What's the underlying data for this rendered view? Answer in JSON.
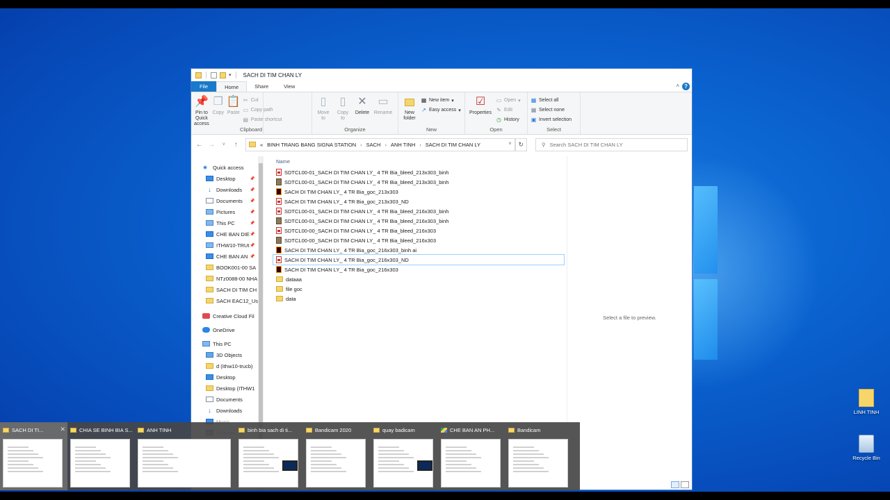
{
  "window": {
    "title": "SACH DI TIM CHAN LY",
    "tabs": [
      "File",
      "Home",
      "Share",
      "View"
    ]
  },
  "ribbon": {
    "clipboard": {
      "name": "Clipboard",
      "pin": "Pin to Quick access",
      "copy": "Copy",
      "paste": "Paste",
      "cut": "Cut",
      "copy_path": "Copy path",
      "paste_shortcut": "Paste shortcut"
    },
    "organize": {
      "name": "Organize",
      "move_to": "Move to",
      "copy_to": "Copy to",
      "delete": "Delete",
      "rename": "Rename"
    },
    "new": {
      "name": "New",
      "new_folder": "New folder",
      "new_item": "New item",
      "easy_access": "Easy access"
    },
    "open": {
      "name": "Open",
      "properties": "Properties",
      "open": "Open",
      "edit": "Edit",
      "history": "History"
    },
    "select": {
      "name": "Select",
      "select_all": "Select all",
      "select_none": "Select none",
      "invert": "Invert selection"
    }
  },
  "address": {
    "prefix": "«",
    "crumbs": [
      "BINH TRANG BANG SIGNA STATION",
      "SACH",
      "ANH TINH",
      "SACH DI TIM CHAN LY"
    ],
    "search_placeholder": "Search SACH DI TIM CHAN LY"
  },
  "nav": {
    "items": [
      {
        "label": "Quick access",
        "icon": "star-icon"
      },
      {
        "label": "Desktop",
        "icon": "desktop-icon"
      },
      {
        "label": "Downloads",
        "icon": "download-icon"
      },
      {
        "label": "Documents",
        "icon": "documents-icon"
      },
      {
        "label": "Pictures",
        "icon": "pictures-icon"
      },
      {
        "label": "This PC",
        "icon": "pc-icon"
      },
      {
        "label": "CHE BAN DIE",
        "icon": "drive-icon"
      },
      {
        "label": "ITHW10-TRUt",
        "icon": "network-drive-icon"
      },
      {
        "label": "CHE BAN AN",
        "icon": "drive-icon"
      },
      {
        "label": "BOOK001-00 SA",
        "icon": "folder-icon"
      },
      {
        "label": "NTz0088-00 NHA",
        "icon": "folder-icon"
      },
      {
        "label": "SACH DI TIM CH",
        "icon": "folder-icon"
      },
      {
        "label": "SACH EAC12_Us",
        "icon": "folder-icon"
      },
      {
        "label": "Creative Cloud Fil",
        "icon": "creative-cloud-icon"
      },
      {
        "label": "OneDrive",
        "icon": "onedrive-icon"
      },
      {
        "label": "This PC",
        "icon": "pc-icon"
      },
      {
        "label": "3D Objects",
        "icon": "3d-objects-icon"
      },
      {
        "label": "d (Ithw10-trucb)",
        "icon": "folder-icon"
      },
      {
        "label": "Desktop",
        "icon": "desktop-icon"
      },
      {
        "label": "Desktop (ITHW1",
        "icon": "folder-icon"
      },
      {
        "label": "Documents",
        "icon": "documents-icon"
      },
      {
        "label": "Downloads",
        "icon": "download-icon"
      },
      {
        "label": "Music",
        "icon": "music-icon"
      },
      {
        "label": "Pictures",
        "icon": "pictures-icon"
      }
    ]
  },
  "files": {
    "column_name": "Name",
    "rows": [
      {
        "name": "SDTCL00-01_SACH DI TIM CHAN LY_ 4 TR Bia_bleed_213x303_binh",
        "type": "pdf"
      },
      {
        "name": "SDTCL00-01_SACH DI TIM CHAN LY_ 4 TR Bia_bleed_213x303_binh",
        "type": "tif"
      },
      {
        "name": "SACH DI TIM CHAN LY_ 4 TR Bia_goc_213x303",
        "type": "ai"
      },
      {
        "name": "SACH DI TIM CHAN LY_ 4 TR Bia_goc_213x303_ND",
        "type": "pdf"
      },
      {
        "name": "SDTCL00-01_SACH DI TIM CHAN LY_ 4 TR Bia_bleed_216x303_binh",
        "type": "pdf"
      },
      {
        "name": "SDTCL00-01_SACH DI TIM CHAN LY_ 4 TR Bia_bleed_216x303_binh",
        "type": "tif"
      },
      {
        "name": "SDTCL00-00_SACH DI TIM CHAN LY_ 4 TR Bia_bleed_216x303",
        "type": "pdf"
      },
      {
        "name": "SDTCL00-00_SACH DI TIM CHAN LY_ 4 TR Bia_bleed_216x303",
        "type": "tif"
      },
      {
        "name": "SACH DI TIM CHAN LY_ 4 TR Bia_goc_216x303_binh ai",
        "type": "ai"
      },
      {
        "name": "SACH DI TIM CHAN LY_ 4 TR Bia_goc_216x303_ND",
        "type": "pdf"
      },
      {
        "name": "SACH DI TIM CHAN LY_ 4 TR Bia_goc_216x303",
        "type": "ai"
      },
      {
        "name": "dataaa",
        "type": "folder"
      },
      {
        "name": "file goc",
        "type": "folder"
      },
      {
        "name": "data",
        "type": "folder"
      }
    ]
  },
  "preview": {
    "text": "Select a file to preview."
  },
  "switcher": {
    "items": [
      {
        "label": "SACH DI TI...",
        "icon": "folder-icon"
      },
      {
        "label": "CHIA SE BINH BIA S...",
        "icon": "folder-icon"
      },
      {
        "label": "ANH TINH",
        "icon": "folder-icon"
      },
      {
        "label": "binh bia sach di ti...",
        "icon": "folder-icon"
      },
      {
        "label": "Bandicam 2020",
        "icon": "folder-icon"
      },
      {
        "label": "quay badicam",
        "icon": "folder-icon"
      },
      {
        "label": "CHE BAN AN PH...",
        "icon": "google-drive-icon"
      },
      {
        "label": "Bandicam",
        "icon": "folder-icon"
      }
    ]
  },
  "desktop": {
    "icons": [
      {
        "label": "LINH TINH",
        "icon": "folder-icon"
      },
      {
        "label": "Recycle Bin",
        "icon": "recycle-bin-icon"
      }
    ]
  },
  "colors": {
    "accent": "#1979ca",
    "desktop": "#0a63d0",
    "folder": "#f6d66b"
  }
}
